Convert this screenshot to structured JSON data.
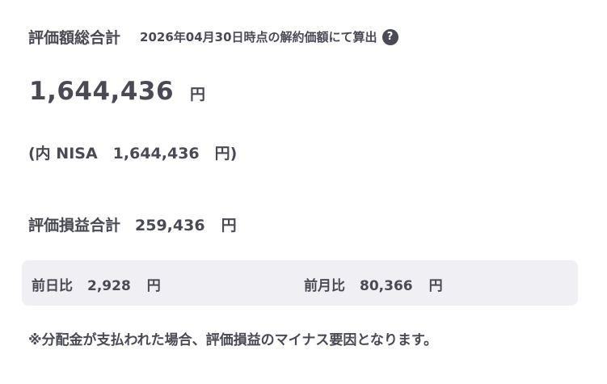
{
  "header": {
    "title": "評価額総合計",
    "as_of": "2026年04月30日時点の解約価額にて算出",
    "help_symbol": "?"
  },
  "total": {
    "value": "1,644,436",
    "unit": "円"
  },
  "nisa": {
    "text": "(内 NISA　1,644,436　円)"
  },
  "profit_loss": {
    "label": "評価損益合計",
    "value": "259,436",
    "unit": "円"
  },
  "compare": {
    "day": {
      "label": "前日比",
      "value": "2,928",
      "unit": "円"
    },
    "month": {
      "label": "前月比",
      "value": "80,366",
      "unit": "円"
    }
  },
  "note": "※分配金が支払われた場合、評価損益のマイナス要因となります。",
  "colors": {
    "text": "#4a4a55",
    "box_bg": "#f0f0f4",
    "icon_bg": "#4a4a55"
  },
  "icons": {
    "help": "question-circle"
  }
}
